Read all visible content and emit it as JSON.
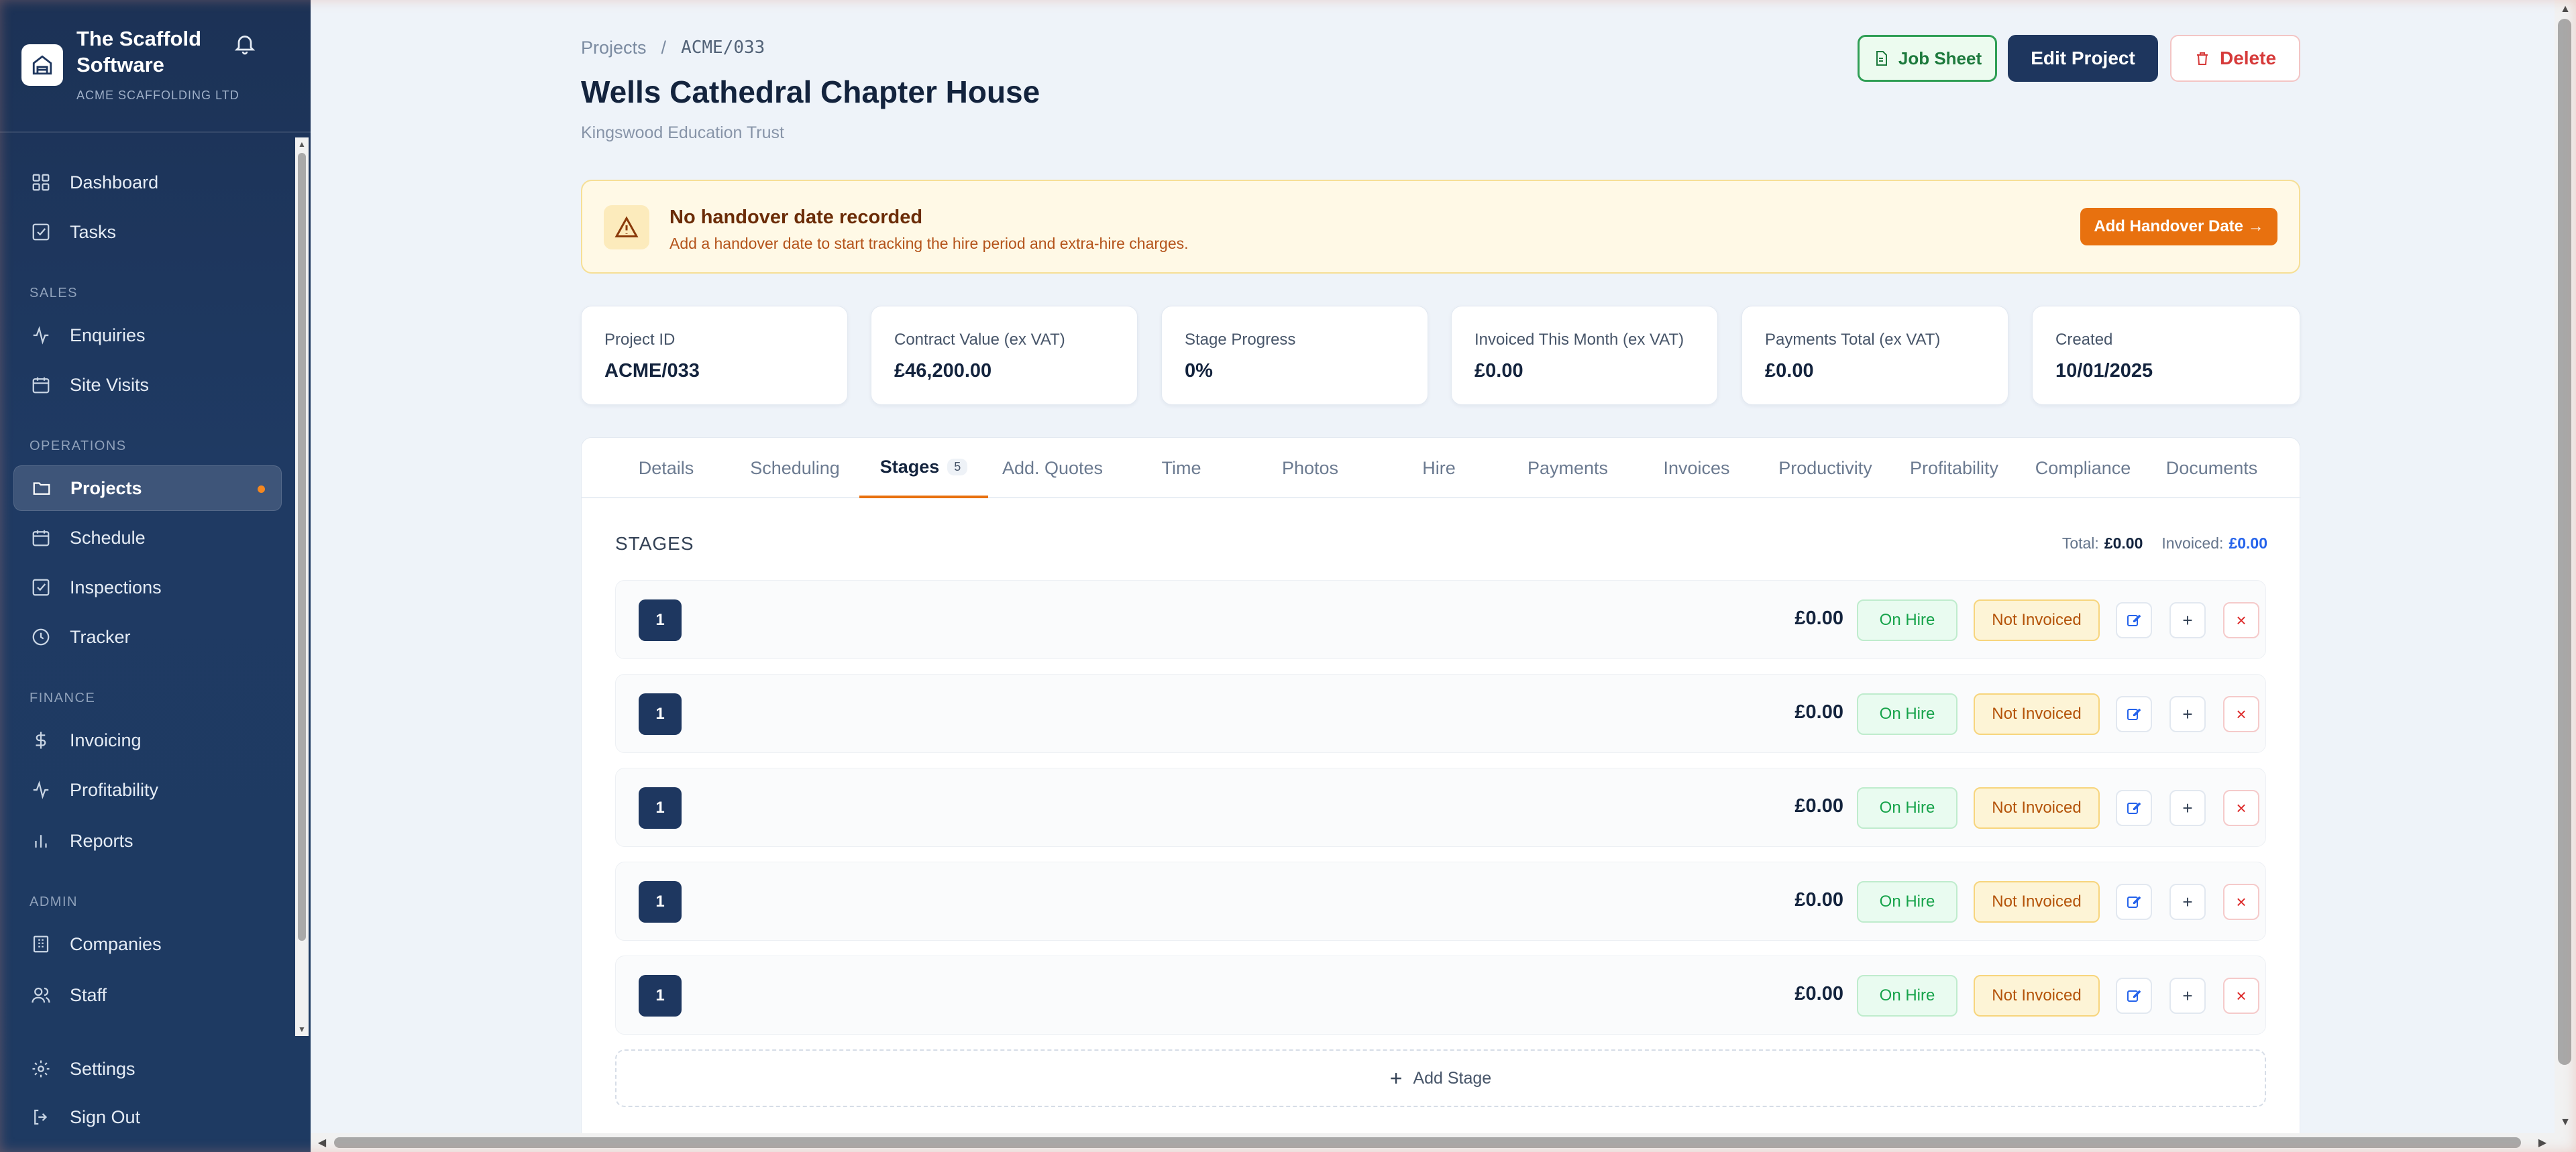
{
  "brand": {
    "title": "The Scaffold Software",
    "company": "ACME SCAFFOLDING LTD"
  },
  "nav": {
    "dashboard": "Dashboard",
    "tasks": "Tasks",
    "section_sales": "SALES",
    "enquiries": "Enquiries",
    "site_visits": "Site Visits",
    "section_operations": "OPERATIONS",
    "projects": "Projects",
    "schedule": "Schedule",
    "inspections": "Inspections",
    "tracker": "Tracker",
    "section_finance": "FINANCE",
    "invoicing": "Invoicing",
    "profitability": "Profitability",
    "reports": "Reports",
    "section_admin": "ADMIN",
    "companies": "Companies",
    "staff": "Staff",
    "settings": "Settings",
    "sign_out": "Sign Out"
  },
  "breadcrumb": {
    "parent": "Projects",
    "separator": "/",
    "current": "ACME/033"
  },
  "header": {
    "title": "Wells Cathedral Chapter House",
    "client": "Kingswood Education Trust",
    "job_sheet": "Job Sheet",
    "edit": "Edit Project",
    "delete": "Delete"
  },
  "alert": {
    "title": "No handover date recorded",
    "text": "Add a handover date to start tracking the hire period and extra-hire charges.",
    "button": "Add Handover Date →"
  },
  "stats": [
    {
      "label": "Project ID",
      "value": "ACME/033"
    },
    {
      "label": "Contract Value (ex VAT)",
      "value": "£46,200.00"
    },
    {
      "label": "Stage Progress",
      "value": "0%"
    },
    {
      "label": "Invoiced This Month (ex VAT)",
      "value": "£0.00"
    },
    {
      "label": "Payments Total (ex VAT)",
      "value": "£0.00"
    },
    {
      "label": "Created",
      "value": "10/01/2025"
    }
  ],
  "tabs": [
    {
      "label": "Details"
    },
    {
      "label": "Scheduling"
    },
    {
      "label": "Stages",
      "badge": "5"
    },
    {
      "label": "Add. Quotes"
    },
    {
      "label": "Time"
    },
    {
      "label": "Photos"
    },
    {
      "label": "Hire"
    },
    {
      "label": "Payments"
    },
    {
      "label": "Invoices"
    },
    {
      "label": "Productivity"
    },
    {
      "label": "Profitability"
    },
    {
      "label": "Compliance"
    },
    {
      "label": "Documents"
    }
  ],
  "stages": {
    "heading": "STAGES",
    "total_label": "Total:",
    "total_value": "£0.00",
    "invoiced_label": "Invoiced:",
    "invoiced_value": "£0.00",
    "rows": [
      {
        "number": "1",
        "amount": "£0.00",
        "hire_status": "On Hire",
        "invoice_status": "Not Invoiced"
      },
      {
        "number": "1",
        "amount": "£0.00",
        "hire_status": "On Hire",
        "invoice_status": "Not Invoiced"
      },
      {
        "number": "1",
        "amount": "£0.00",
        "hire_status": "On Hire",
        "invoice_status": "Not Invoiced"
      },
      {
        "number": "1",
        "amount": "£0.00",
        "hire_status": "On Hire",
        "invoice_status": "Not Invoiced"
      },
      {
        "number": "1",
        "amount": "£0.00",
        "hire_status": "On Hire",
        "invoice_status": "Not Invoiced"
      }
    ],
    "row_add_glyph": "+",
    "row_delete_glyph": "×",
    "add_stage": "Add Stage"
  }
}
